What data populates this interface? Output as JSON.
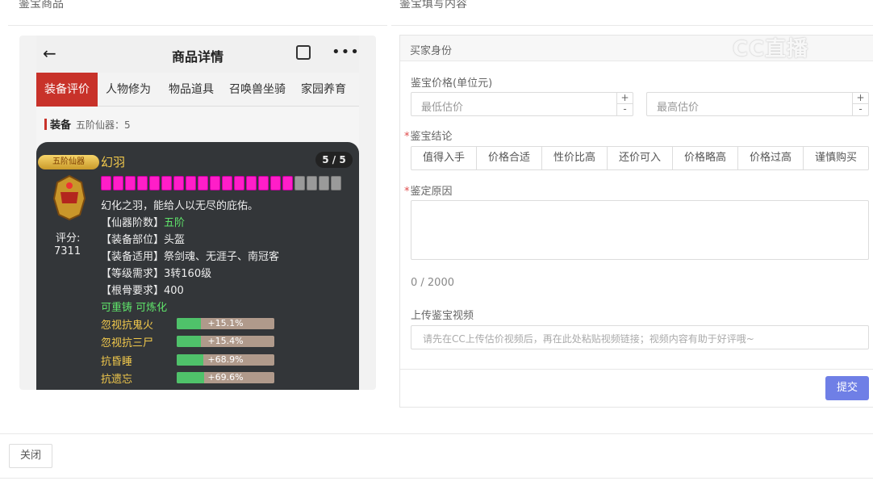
{
  "left_section_title": "鉴宝商品",
  "right_section_title": "鉴宝填写内容",
  "phone": {
    "back_icon": "←",
    "title": "商品详情",
    "more_icon": "•••",
    "tabs": [
      "装备评价",
      "人物修为",
      "物品道具",
      "召唤兽坐骑",
      "家园养育"
    ],
    "active_tab": 0,
    "equip_label": "装备",
    "equip_sub": "五阶仙器：5",
    "item": {
      "badge": "五阶仙器",
      "name": "幻羽",
      "count": "5 / 5",
      "dots_total": 20,
      "dots_filled": 16,
      "score_label": "评分:",
      "score_value": "7311",
      "lines": [
        {
          "prefix": "幻化之羽，能给人以无尽的庇佑。",
          "value": ""
        },
        {
          "prefix": "【仙器阶数】",
          "value": "五阶",
          "green": true
        },
        {
          "prefix": "【装备部位】",
          "value": "头盔"
        },
        {
          "prefix": "【装备适用】",
          "value": "祭剑魂、无涯子、南冠客"
        },
        {
          "prefix": "【等级需求】",
          "value": "3转160级"
        },
        {
          "prefix": "【根骨要求】",
          "value": "400"
        }
      ],
      "green_line": "可重铸 可炼化",
      "attrs": [
        {
          "name": "忽视抗鬼火",
          "value": "+15.1%",
          "pct": 15.1
        },
        {
          "name": "忽视抗三尸",
          "value": "+15.4%",
          "pct": 15.4
        },
        {
          "name": "抗昏睡",
          "value": "+68.9%",
          "pct": 68.9
        },
        {
          "name": "抗遗忘",
          "value": "+69.6%",
          "pct": 69.6
        }
      ]
    }
  },
  "form": {
    "header": "买家身份",
    "price_label": "鉴宝价格(单位元)",
    "min_placeholder": "最低估价",
    "max_placeholder": "最高估价",
    "conclusion_label": "鉴宝结论",
    "conclusions": [
      "值得入手",
      "价格合适",
      "性价比高",
      "还价可入",
      "价格略高",
      "价格过高",
      "谨慎购买"
    ],
    "reason_label": "鉴定原因",
    "counter": "0 / 2000",
    "video_label": "上传鉴宝视频",
    "video_placeholder": "请先在CC上传估价视频后，再在此处粘贴视频链接；视频内容有助于好评哦~",
    "submit": "提交"
  },
  "close_label": "关闭",
  "watermark": "CC直播"
}
